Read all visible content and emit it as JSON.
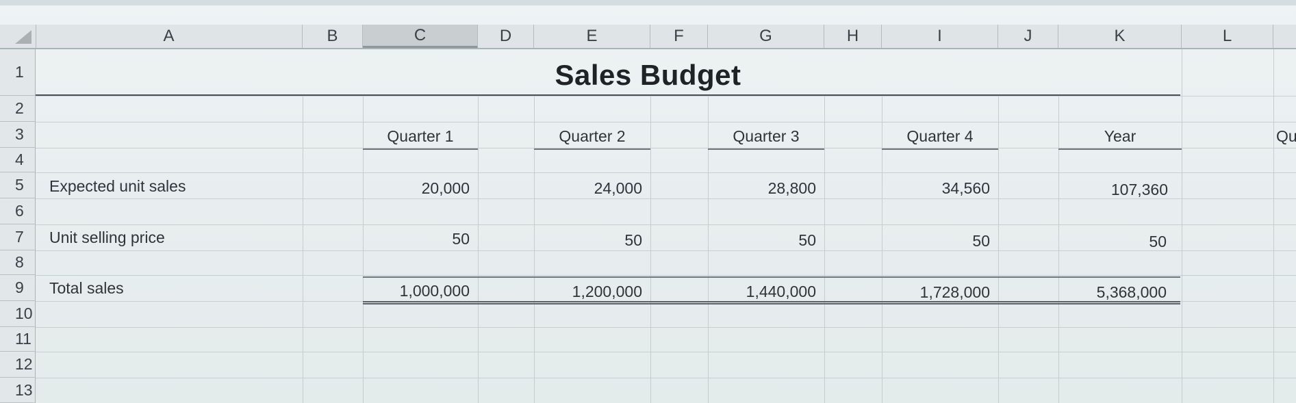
{
  "sheet": {
    "title": "Sales Budget",
    "column_letters": [
      "A",
      "B",
      "C",
      "D",
      "E",
      "F",
      "G",
      "H",
      "I",
      "J",
      "K",
      "L"
    ],
    "selected_column": "C",
    "row_numbers": [
      "1",
      "2",
      "3",
      "4",
      "5",
      "6",
      "7",
      "8",
      "9",
      "10",
      "11",
      "12",
      "13"
    ],
    "headers": [
      "Quarter 1",
      "Quarter 2",
      "Quarter 3",
      "Quarter 4",
      "Year"
    ],
    "offscreen_header_fragment": "Qu",
    "rows": [
      {
        "label": "Expected unit sales",
        "values": [
          "20,000",
          "24,000",
          "28,800",
          "34,560",
          "107,360"
        ]
      },
      {
        "label": "Unit selling price",
        "values": [
          "50",
          "50",
          "50",
          "50",
          "50"
        ]
      },
      {
        "label": "Total sales",
        "values": [
          "1,000,000",
          "1,200,000",
          "1,440,000",
          "1,728,000",
          "5,368,000"
        ]
      }
    ]
  }
}
